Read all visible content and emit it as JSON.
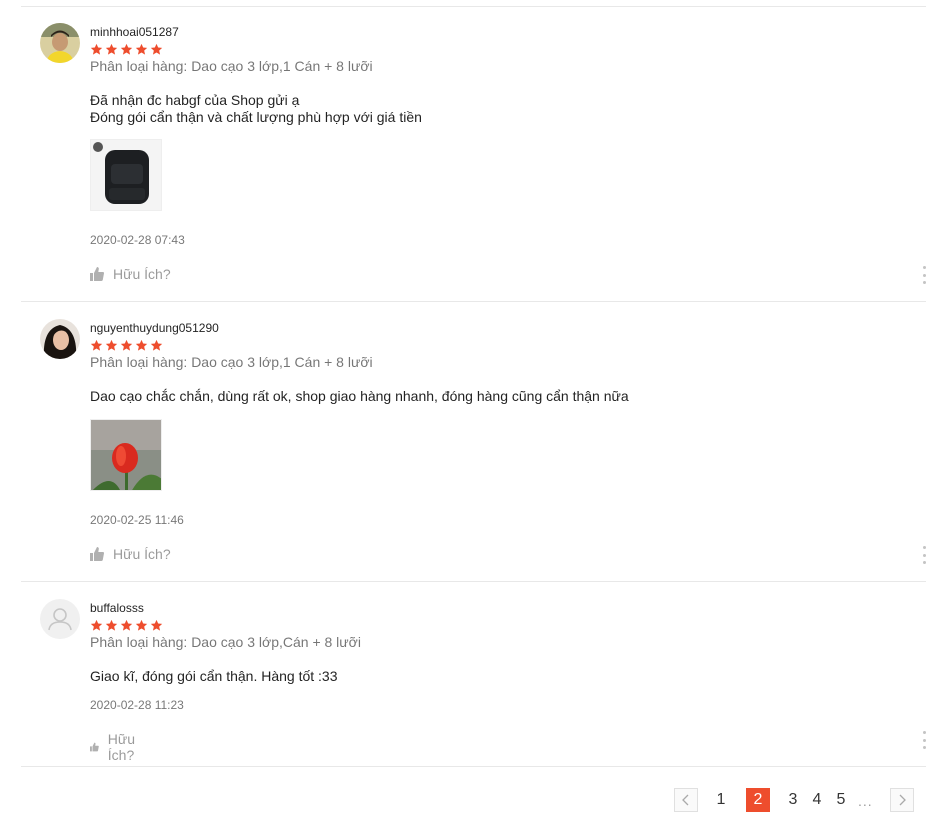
{
  "colors": {
    "star": "#ee4d2d",
    "active_page": "#ee4d2d"
  },
  "reviews": [
    {
      "author": "minhhoai051287",
      "rating": 5,
      "variation": "Phân loại hàng: Dao cạo 3 lớp,1 Cán + 8 lưỡi",
      "text_lines": [
        "Đã nhận đc habgf của Shop gửi ạ",
        "Đóng gói cẩn thận và chất lượng phù hợp với giá tiền"
      ],
      "time": "2020-02-28 07:43",
      "helpful": "Hữu Ích?"
    },
    {
      "author": "nguyenthuydung051290",
      "rating": 5,
      "variation": "Phân loại hàng: Dao cạo 3 lớp,1 Cán + 8 lưỡi",
      "text_lines": [
        "Dao cạo chắc chắn, dùng rất ok, shop giao hàng nhanh, đóng hàng cũng cẩn thận nữa"
      ],
      "time": "2020-02-25 11:46",
      "helpful": "Hữu Ích?"
    },
    {
      "author": "buffalosss",
      "rating": 5,
      "variation": "Phân loại hàng: Dao cạo 3 lớp,Cán + 8 lưỡi",
      "text_lines": [
        "Giao kĩ, đóng gói cẩn thận. Hàng tốt :33"
      ],
      "time": "2020-02-28 11:23",
      "helpful": "Hữu Ích?"
    }
  ],
  "pagination": {
    "pages": [
      "1",
      "2",
      "3",
      "4",
      "5"
    ],
    "current": "2",
    "ellipsis": "..."
  }
}
